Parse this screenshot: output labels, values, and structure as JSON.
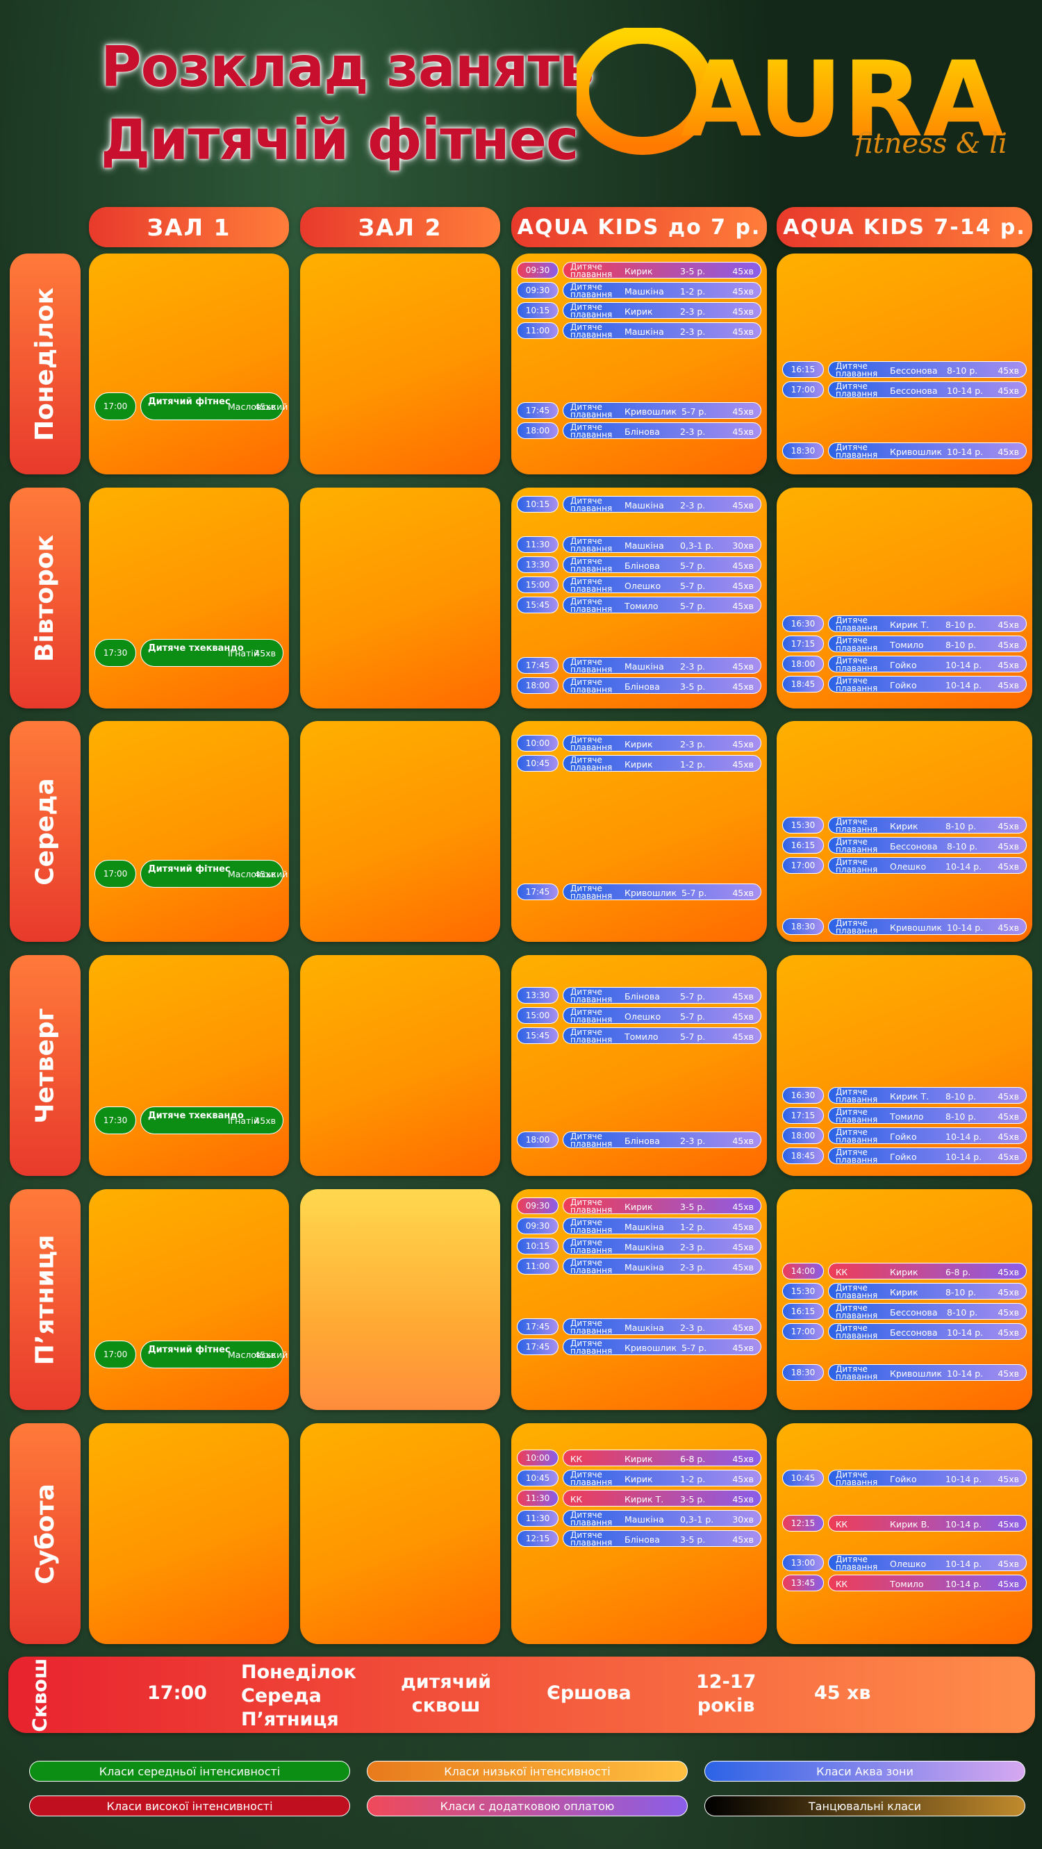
{
  "title": {
    "line1": "Розклад занять",
    "line2": "Дитячій фітнес"
  },
  "logo": {
    "brand": "AURA",
    "tagline": "fitness & life"
  },
  "columns": [
    "ЗАЛ 1",
    "ЗАЛ 2",
    "AQUA KIDS до 7 р.",
    "AQUA KIDS  7-14 р."
  ],
  "days": [
    "Понеділок",
    "Вівторок",
    "Середа",
    "Четверг",
    "П’ятниця",
    "Субота"
  ],
  "schedule": {
    "mon": {
      "zal1": [
        {
          "time": "17:00",
          "name": "Дитячий фітнес",
          "instructor": "Масловський",
          "dur": "45хв"
        }
      ],
      "aq1": [
        {
          "time": "09:30",
          "name": "Дитяче плавання",
          "instructor": "Кирик",
          "age": "3-5 р.",
          "dur": "45хв",
          "kind": "kk"
        },
        {
          "time": "09:30",
          "name": "Дитяче плавання",
          "instructor": "Машкіна",
          "age": "1-2 р.",
          "dur": "45хв"
        },
        {
          "time": "10:15",
          "name": "Дитяче плавання",
          "instructor": "Кирик",
          "age": "2-3 р.",
          "dur": "45хв"
        },
        {
          "time": "11:00",
          "name": "Дитяче плавання",
          "instructor": "Машкіна",
          "age": "2-3 р.",
          "dur": "45хв"
        },
        {
          "time": "17:45",
          "name": "Дитяче плавання",
          "instructor": "Кривошлик",
          "age": "5-7 р.",
          "dur": "45хв"
        },
        {
          "time": "18:00",
          "name": "Дитяче плавання",
          "instructor": "Блінова",
          "age": "2-3 р.",
          "dur": "45хв"
        }
      ],
      "aq2": [
        {
          "time": "16:15",
          "name": "Дитяче плавання",
          "instructor": "Бессонова",
          "age": "8-10 р.",
          "dur": "45хв"
        },
        {
          "time": "17:00",
          "name": "Дитяче плавання",
          "instructor": "Бессонова",
          "age": "10-14 р.",
          "dur": "45хв"
        },
        {
          "time": "18:30",
          "name": "Дитяче плавання",
          "instructor": "Кривошлик",
          "age": "10-14 р.",
          "dur": "45хв"
        }
      ]
    },
    "tue": {
      "zal1": [
        {
          "time": "17:30",
          "name": "Дитяче тхеквандо",
          "instructor": "Ігнатій",
          "dur": "45хв"
        }
      ],
      "aq1": [
        {
          "time": "10:15",
          "name": "Дитяче плавання",
          "instructor": "Машкіна",
          "age": "2-3 р.",
          "dur": "45хв"
        },
        {
          "time": "11:30",
          "name": "Дитяче плавання",
          "instructor": "Машкіна",
          "age": "0,3-1 р.",
          "dur": "30хв"
        },
        {
          "time": "13:30",
          "name": "Дитяче плавання",
          "instructor": "Блінова",
          "age": "5-7 р.",
          "dur": "45хв"
        },
        {
          "time": "15:00",
          "name": "Дитяче плавання",
          "instructor": "Олешко",
          "age": "5-7 р.",
          "dur": "45хв"
        },
        {
          "time": "15:45",
          "name": "Дитяче плавання",
          "instructor": "Томило",
          "age": "5-7 р.",
          "dur": "45хв"
        },
        {
          "time": "17:45",
          "name": "Дитяче плавання",
          "instructor": "Машкіна",
          "age": "2-3 р.",
          "dur": "45хв"
        },
        {
          "time": "18:00",
          "name": "Дитяче плавання",
          "instructor": "Блінова",
          "age": "3-5 р.",
          "dur": "45хв"
        }
      ],
      "aq2": [
        {
          "time": "16:30",
          "name": "Дитяче плавання",
          "instructor": "Кирик Т.",
          "age": "8-10 р.",
          "dur": "45хв"
        },
        {
          "time": "17:15",
          "name": "Дитяче плавання",
          "instructor": "Томило",
          "age": "8-10 р.",
          "dur": "45хв"
        },
        {
          "time": "18:00",
          "name": "Дитяче плавання",
          "instructor": "Гойко",
          "age": "10-14 р.",
          "dur": "45хв"
        },
        {
          "time": "18:45",
          "name": "Дитяче плавання",
          "instructor": "Гойко",
          "age": "10-14 р.",
          "dur": "45хв"
        }
      ]
    },
    "wed": {
      "zal1": [
        {
          "time": "17:00",
          "name": "Дитячий фітнес",
          "instructor": "Масловський",
          "dur": "45хв"
        }
      ],
      "aq1": [
        {
          "time": "10:00",
          "name": "Дитяче плавання",
          "instructor": "Кирик",
          "age": "2-3 р.",
          "dur": "45хв"
        },
        {
          "time": "10:45",
          "name": "Дитяче плавання",
          "instructor": "Кирик",
          "age": "1-2 р.",
          "dur": "45хв"
        },
        {
          "time": "17:45",
          "name": "Дитяче плавання",
          "instructor": "Кривошлик",
          "age": "5-7 р.",
          "dur": "45хв"
        }
      ],
      "aq2": [
        {
          "time": "15:30",
          "name": "Дитяче плавання",
          "instructor": "Кирик",
          "age": "8-10 р.",
          "dur": "45хв"
        },
        {
          "time": "16:15",
          "name": "Дитяче плавання",
          "instructor": "Бессонова",
          "age": "8-10 р.",
          "dur": "45хв"
        },
        {
          "time": "17:00",
          "name": "Дитяче плавання",
          "instructor": "Олешко",
          "age": "10-14 р.",
          "dur": "45хв"
        },
        {
          "time": "18:30",
          "name": "Дитяче плавання",
          "instructor": "Кривошлик",
          "age": "10-14 р.",
          "dur": "45хв"
        }
      ]
    },
    "thu": {
      "zal1": [
        {
          "time": "17:30",
          "name": "Дитяче тхеквандо",
          "instructor": "Ігнатій",
          "dur": "45хв"
        }
      ],
      "aq1": [
        {
          "time": "13:30",
          "name": "Дитяче плавання",
          "instructor": "Блінова",
          "age": "5-7 р.",
          "dur": "45хв"
        },
        {
          "time": "15:00",
          "name": "Дитяче плавання",
          "instructor": "Олешко",
          "age": "5-7 р.",
          "dur": "45хв"
        },
        {
          "time": "15:45",
          "name": "Дитяче плавання",
          "instructor": "Томило",
          "age": "5-7 р.",
          "dur": "45хв"
        },
        {
          "time": "18:00",
          "name": "Дитяче плавання",
          "instructor": "Блінова",
          "age": "2-3 р.",
          "dur": "45хв"
        }
      ],
      "aq2": [
        {
          "time": "16:30",
          "name": "Дитяче плавання",
          "instructor": "Кирик Т.",
          "age": "8-10 р.",
          "dur": "45хв"
        },
        {
          "time": "17:15",
          "name": "Дитяче плавання",
          "instructor": "Томило",
          "age": "8-10 р.",
          "dur": "45хв"
        },
        {
          "time": "18:00",
          "name": "Дитяче плавання",
          "instructor": "Гойко",
          "age": "10-14 р.",
          "dur": "45хв"
        },
        {
          "time": "18:45",
          "name": "Дитяче плавання",
          "instructor": "Гойко",
          "age": "10-14 р.",
          "dur": "45хв"
        }
      ]
    },
    "fri": {
      "zal1": [
        {
          "time": "17:00",
          "name": "Дитячий фітнес",
          "instructor": "Масловський",
          "dur": "45хв"
        }
      ],
      "aq1": [
        {
          "time": "09:30",
          "name": "Дитяче плавання",
          "instructor": "Кирик",
          "age": "3-5 р.",
          "dur": "45хв",
          "kind": "kk"
        },
        {
          "time": "09:30",
          "name": "Дитяче плавання",
          "instructor": "Машкіна",
          "age": "1-2 р.",
          "dur": "45хв"
        },
        {
          "time": "10:15",
          "name": "Дитяче плавання",
          "instructor": "Машкіна",
          "age": "2-3 р.",
          "dur": "45хв"
        },
        {
          "time": "11:00",
          "name": "Дитяче плавання",
          "instructor": "Машкіна",
          "age": "2-3 р.",
          "dur": "45хв"
        },
        {
          "time": "17:45",
          "name": "Дитяче плавання",
          "instructor": "Машкіна",
          "age": "2-3 р.",
          "dur": "45хв"
        },
        {
          "time": "17:45",
          "name": "Дитяче плавання",
          "instructor": "Кривошлик",
          "age": "5-7 р.",
          "dur": "45хв"
        }
      ],
      "aq2": [
        {
          "time": "14:00",
          "name": "КК",
          "instructor": "Кирик",
          "age": "6-8 р.",
          "dur": "45хв",
          "kind": "kk"
        },
        {
          "time": "15:30",
          "name": "Дитяче плавання",
          "instructor": "Кирик",
          "age": "8-10 р.",
          "dur": "45хв"
        },
        {
          "time": "16:15",
          "name": "Дитяче плавання",
          "instructor": "Бессонова",
          "age": "8-10 р.",
          "dur": "45хв"
        },
        {
          "time": "17:00",
          "name": "Дитяче плавання",
          "instructor": "Бессонова",
          "age": "10-14 р.",
          "dur": "45хв"
        },
        {
          "time": "18:30",
          "name": "Дитяче плавання",
          "instructor": "Кривошлик",
          "age": "10-14 р.",
          "dur": "45хв"
        }
      ]
    },
    "sat": {
      "aq1": [
        {
          "time": "10:00",
          "name": "КК",
          "instructor": "Кирик",
          "age": "6-8 р.",
          "dur": "45хв",
          "kind": "kk"
        },
        {
          "time": "10:45",
          "name": "Дитяче плавання",
          "instructor": "Кирик",
          "age": "1-2 р.",
          "dur": "45хв"
        },
        {
          "time": "11:30",
          "name": "КК",
          "instructor": "Кирик Т.",
          "age": "3-5 р.",
          "dur": "45хв",
          "kind": "kk"
        },
        {
          "time": "11:30",
          "name": "Дитяче плавання",
          "instructor": "Машкіна",
          "age": "0,3-1 р.",
          "dur": "30хв"
        },
        {
          "time": "12:15",
          "name": "Дитяче плавання",
          "instructor": "Блінова",
          "age": "3-5 р.",
          "dur": "45хв"
        }
      ],
      "aq2": [
        {
          "time": "10:45",
          "name": "Дитяче плавання",
          "instructor": "Гойко",
          "age": "10-14 р.",
          "dur": "45хв"
        },
        {
          "time": "12:15",
          "name": "КК",
          "instructor": "Кирик В.",
          "age": "10-14 р.",
          "dur": "45хв",
          "kind": "kk"
        },
        {
          "time": "13:00",
          "name": "Дитяче плавання",
          "instructor": "Олешко",
          "age": "10-14 р.",
          "dur": "45хв"
        },
        {
          "time": "13:45",
          "name": "КК",
          "instructor": "Томило",
          "age": "10-14 р.",
          "dur": "45хв",
          "kind": "kk"
        }
      ]
    }
  },
  "squash": {
    "label": "Сквош",
    "time": "17:00",
    "days": [
      "Понеділок",
      "Середа",
      "П’ятниця"
    ],
    "activity": [
      "дитячий",
      "сквош"
    ],
    "instructor": "Єршова",
    "age": [
      "12-17",
      "років"
    ],
    "dur": "45 хв"
  },
  "legend": [
    {
      "label": "Класи середньої інтенсивності",
      "color": "#0c8d14"
    },
    {
      "label": "Класи низької інтенсивності",
      "color": "#f2a02c"
    },
    {
      "label": "Класи Аква зони",
      "color": "#5b7ff0"
    },
    {
      "label": "Класи високої інтенсивності",
      "color": "#c8102e"
    },
    {
      "label": "Класи с додатковою оплатою",
      "color": "#d9466e"
    },
    {
      "label": "Танцювальні класи",
      "color": "#3a2a10"
    }
  ],
  "colors": {
    "title": "#c8102e",
    "header": "#ff5a32",
    "cell": "#ff9800",
    "aqua": "#2c63e6",
    "green": "#0c8d14"
  }
}
